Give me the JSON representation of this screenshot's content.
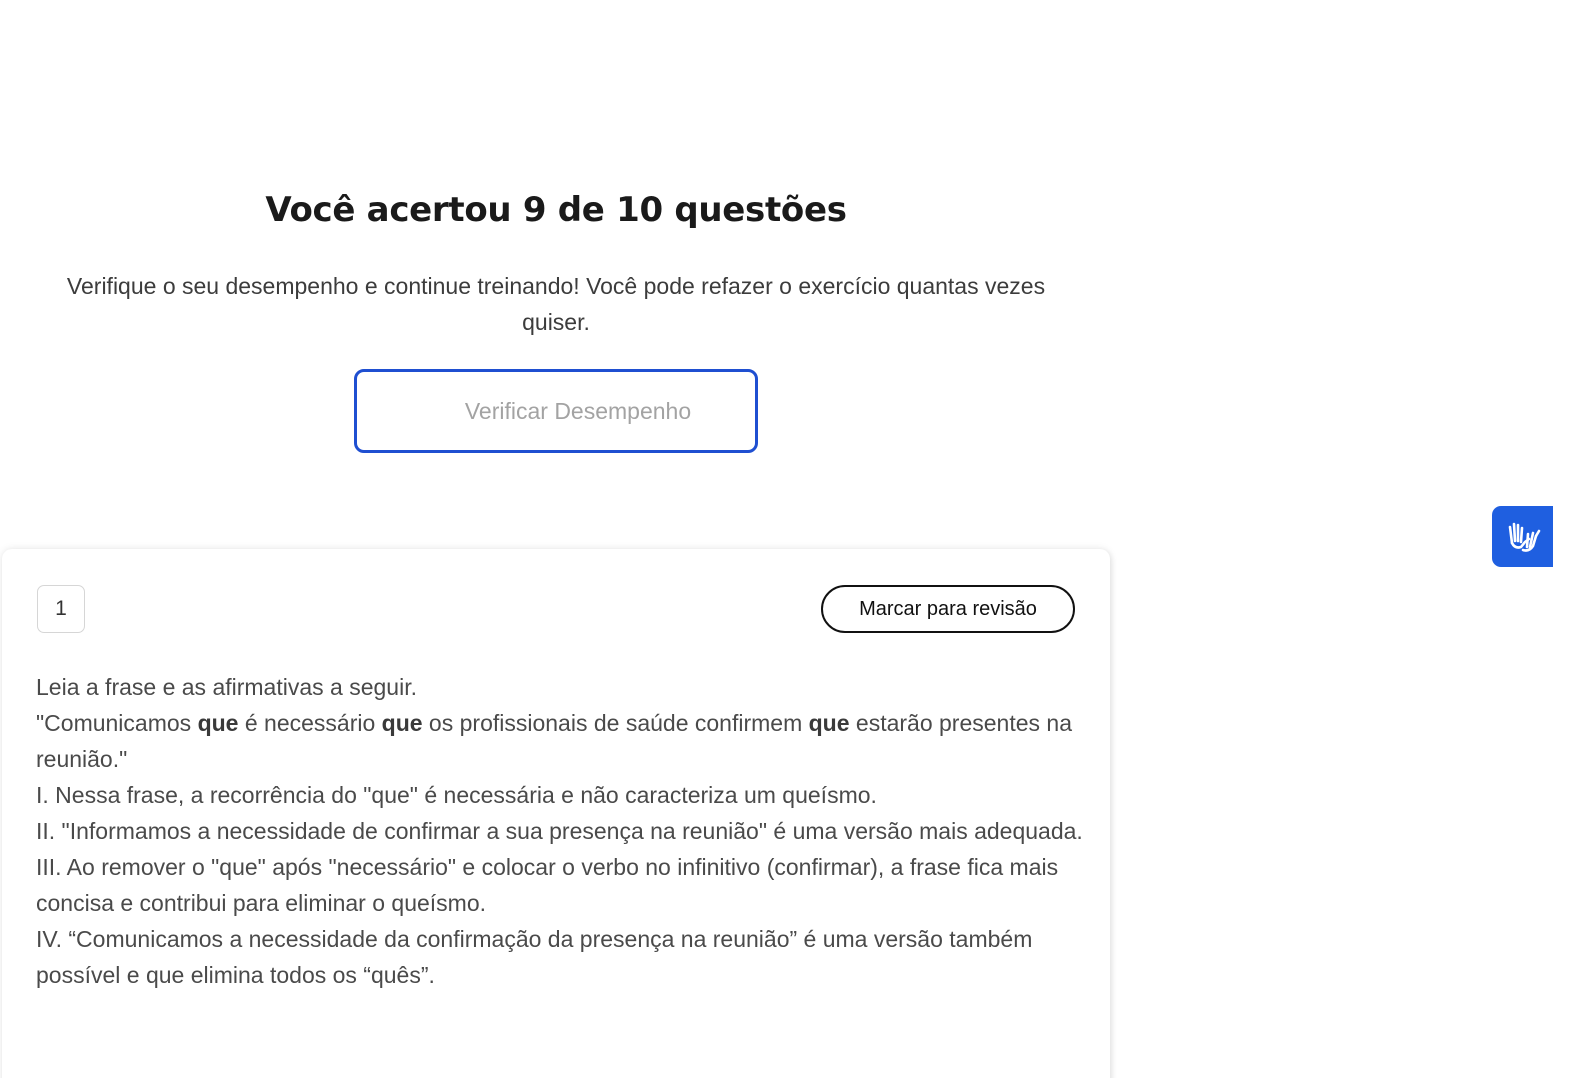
{
  "result": {
    "title": "Você acertou 9 de 10 questões",
    "subtitle": "Verifique o seu desempenho e continue treinando! Você pode refazer o exercício quantas vezes quiser.",
    "verify_button_label": "Verificar Desempenho"
  },
  "question": {
    "number": "1",
    "review_button_label": "Marcar para revisão",
    "intro": "Leia a frase e as afirmativas a seguir.",
    "sentence": {
      "part1": "\"Comunicamos ",
      "que1": "que",
      "part2": " é necessário ",
      "que2": "que",
      "part3": " os profissionais de saúde confirmem ",
      "que3": "que",
      "part4": " estarão presentes na reunião.\""
    },
    "statements": [
      "I. Nessa frase, a recorrência do \"que\" é necessária e não caracteriza um queísmo.",
      "II. \"Informamos a necessidade de confirmar a sua presença na reunião\" é uma versão mais adequada.",
      "III. Ao remover o \"que\" após \"necessário\" e colocar o verbo no infinitivo (confirmar), a frase fica mais concisa e contribui para eliminar o queísmo.",
      "IV. “Comunicamos a necessidade da confirmação da presença na reunião” é uma versão também possível e que elimina todos os “quês”."
    ]
  },
  "accessibility_widget": {
    "icon": "sign-language-hands-icon",
    "color": "#1f5fe0"
  },
  "colors": {
    "accent_border": "#1f4fd1",
    "title_text": "#1a1a1a",
    "body_text": "#4a4a4a",
    "button_label_muted": "#a3a3a3"
  }
}
